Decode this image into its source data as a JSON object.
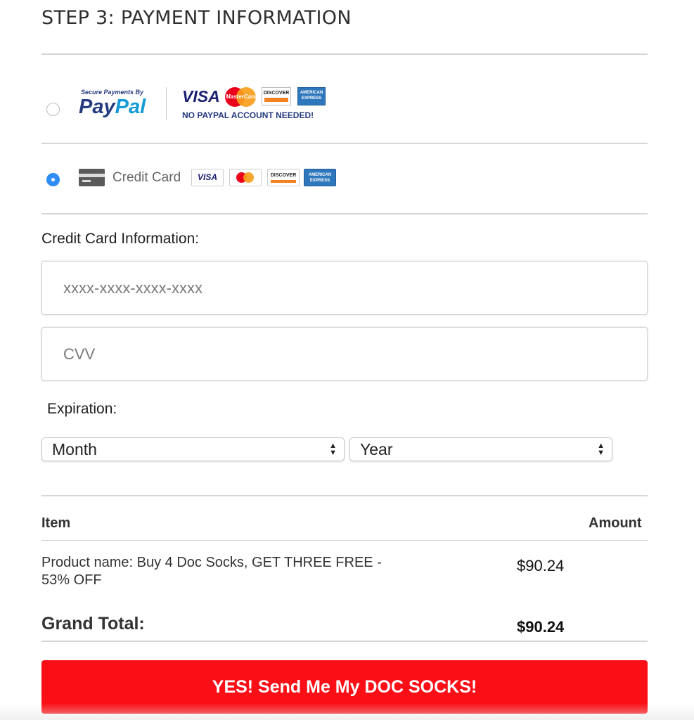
{
  "header": {
    "title": "STEP 3: PAYMENT INFORMATION"
  },
  "payment_options": {
    "paypal": {
      "secure_text": "Secure Payments By",
      "logo_pay": "Pay",
      "logo_pal": "Pal",
      "visa": "VISA",
      "mastercard": "MasterCard",
      "discover": "DISCOVER",
      "amex": "AMERICAN EXPRESS",
      "note": "NO PAYPAL ACCOUNT NEEDED!",
      "selected": false
    },
    "credit_card": {
      "label": "Credit Card",
      "visa": "VISA",
      "discover": "DISCOVER",
      "amex": "AMERICAN EXPRESS",
      "selected": true
    }
  },
  "form": {
    "section_label": "Credit Card Information:",
    "card_number_placeholder": "xxxx-xxxx-xxxx-xxxx",
    "cvv_placeholder": "CVV",
    "expiration_label": "Expiration:",
    "month_value": "Month",
    "year_value": "Year"
  },
  "order": {
    "col_item": "Item",
    "col_amount": "Amount",
    "product_line": "Product name: Buy 4 Doc Socks, GET THREE FREE - 53% OFF",
    "product_amount": "$90.24",
    "grand_total_label": "Grand Total:",
    "grand_total_value": "$90.24"
  },
  "cta": {
    "label": "YES! Send Me My DOC SOCKS!"
  },
  "colors": {
    "cta": "#fb0f16",
    "radio_selected": "#2f8df3",
    "paypal_dark": "#253b80",
    "paypal_light": "#179bd7"
  },
  "icons": [
    "radio-unchecked",
    "paypal-logo",
    "visa-logo",
    "mastercard-logo",
    "discover-logo",
    "amex-logo",
    "radio-checked",
    "credit-card-icon",
    "select-arrows-icon"
  ]
}
